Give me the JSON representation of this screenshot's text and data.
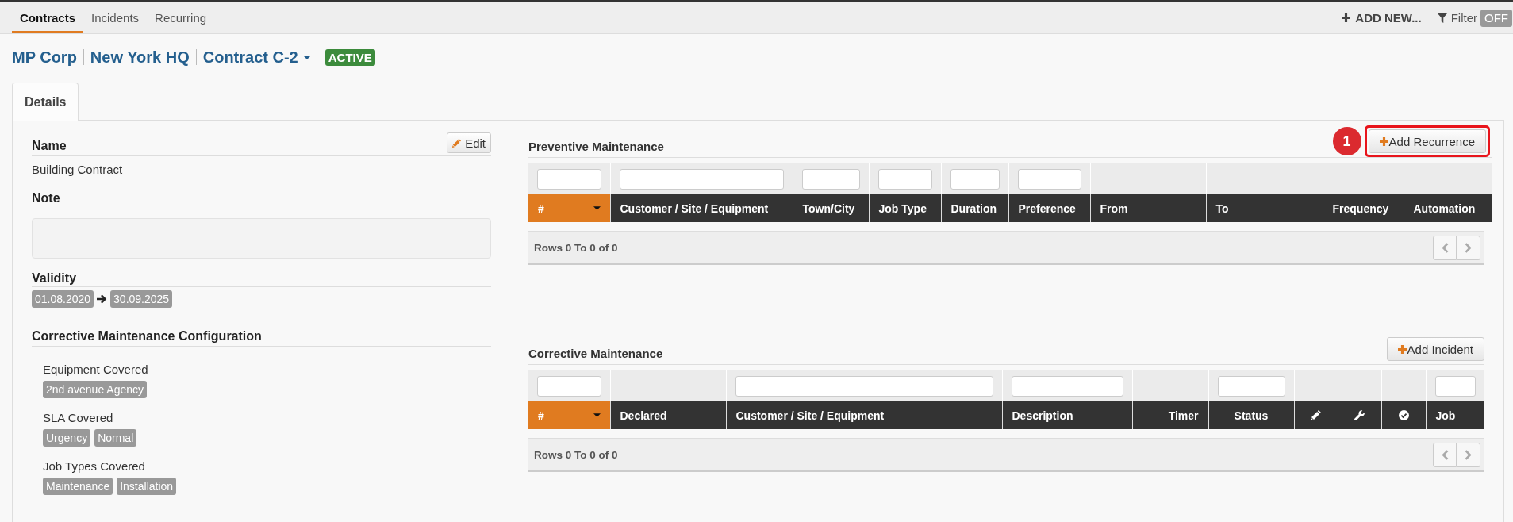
{
  "nav": {
    "tabs": [
      {
        "label": "Contracts",
        "selected": true
      },
      {
        "label": "Incidents",
        "selected": false
      },
      {
        "label": "Recurring",
        "selected": false
      }
    ],
    "add_new": "ADD NEW...",
    "filter": {
      "label": "Filter",
      "state": "OFF",
      "on": false
    }
  },
  "breadcrumb": {
    "items": [
      "MP Corp",
      "New York HQ",
      "Contract C-2"
    ],
    "status": "ACTIVE"
  },
  "detail_tabs": [
    {
      "label": "Details",
      "selected": true
    }
  ],
  "details": {
    "name": {
      "label": "Name",
      "value": "Building Contract",
      "edit_button": "Edit"
    },
    "note": {
      "label": "Note"
    },
    "validity": {
      "label": "Validity",
      "from": "01.08.2020",
      "to": "30.09.2025"
    },
    "corrective_config": {
      "title": "Corrective Maintenance Configuration",
      "groups": [
        {
          "label": "Equipment Covered",
          "tags": [
            "2nd avenue Agency"
          ]
        },
        {
          "label": "SLA Covered",
          "tags": [
            "Urgency",
            "Normal"
          ]
        },
        {
          "label": "Job Types Covered",
          "tags": [
            "Maintenance",
            "Installation"
          ]
        }
      ]
    }
  },
  "preventive": {
    "title": "Preventive Maintenance",
    "add_button": {
      "label": "Add Recurrence",
      "highlighted": true,
      "callout": "1"
    },
    "table": {
      "columns": [
        {
          "label": "#",
          "kind": "text",
          "filter": true,
          "sorted": true
        },
        {
          "label": "Customer / Site / Equipment",
          "kind": "text",
          "filter": true,
          "sorted": false
        },
        {
          "label": "Town/City",
          "kind": "text",
          "filter": true,
          "sorted": false
        },
        {
          "label": "Job Type",
          "kind": "text",
          "filter": true,
          "sorted": false
        },
        {
          "label": "Duration",
          "kind": "text",
          "filter": true,
          "sorted": false
        },
        {
          "label": "Preference",
          "kind": "text",
          "filter": true,
          "sorted": false
        },
        {
          "label": "From",
          "kind": "text",
          "filter": false,
          "sorted": false
        },
        {
          "label": "To",
          "kind": "text",
          "filter": false,
          "sorted": false
        },
        {
          "label": "Frequency",
          "kind": "text",
          "filter": false,
          "sorted": false
        },
        {
          "label": "Automation",
          "kind": "text",
          "filter": false,
          "sorted": false
        }
      ],
      "footer": {
        "text": "Rows 0 To 0 of 0",
        "pager_disabled": true
      }
    }
  },
  "corrective": {
    "title": "Corrective Maintenance",
    "add_button": {
      "label": "Add Incident",
      "highlighted": false
    },
    "table": {
      "columns": [
        {
          "label": "#",
          "kind": "text",
          "filter": true,
          "sorted": true
        },
        {
          "label": "Declared",
          "kind": "text",
          "filter": false,
          "sorted": false
        },
        {
          "label": "Customer / Site / Equipment",
          "kind": "text",
          "filter": true,
          "sorted": false
        },
        {
          "label": "Description",
          "kind": "text",
          "filter": true,
          "sorted": false
        },
        {
          "label": "Timer",
          "kind": "text",
          "filter": false,
          "sorted": false
        },
        {
          "label": "Status",
          "kind": "text",
          "filter": true,
          "sorted": false
        },
        {
          "kind": "pencil",
          "filter": false,
          "sorted": false
        },
        {
          "kind": "wrench",
          "filter": false,
          "sorted": false
        },
        {
          "kind": "check",
          "filter": false,
          "sorted": false
        },
        {
          "label": "Job",
          "kind": "text",
          "filter": true,
          "sorted": false
        }
      ],
      "footer": {
        "text": "Rows 0 To 0 of 0",
        "pager_disabled": true
      }
    }
  }
}
